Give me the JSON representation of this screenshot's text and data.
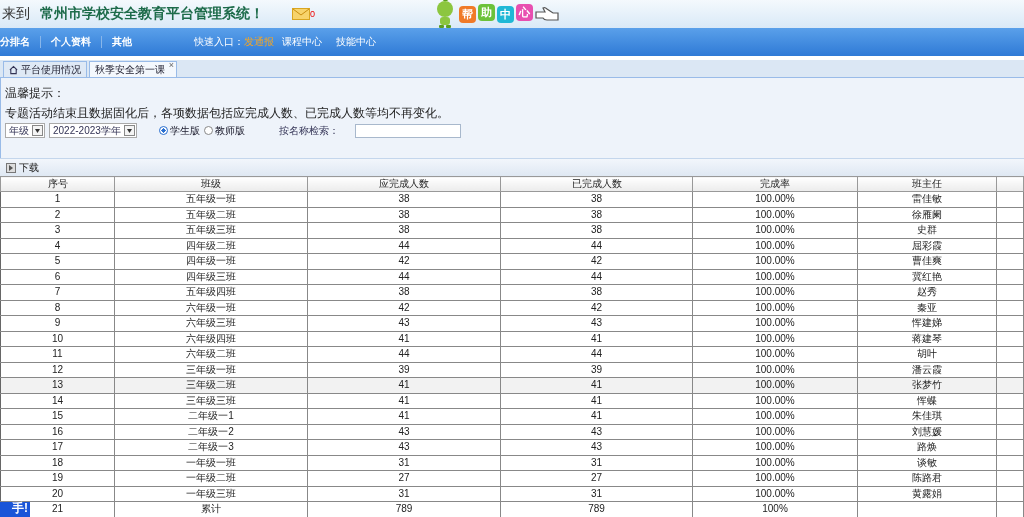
{
  "header": {
    "welcome": "来到",
    "title": "常州市学校安全教育平台管理系统！",
    "mail_count": "0",
    "help_chars": [
      {
        "text": "帮",
        "color": "#f07a28"
      },
      {
        "text": "助",
        "color": "#6cc23a"
      },
      {
        "text": "中",
        "color": "#1fb8d6"
      },
      {
        "text": "心",
        "color": "#e84fb0"
      }
    ]
  },
  "nav": {
    "items": [
      "分排名",
      "个人资料",
      "其他"
    ],
    "quick_label": "快速入口：",
    "quick_links": [
      {
        "label": "发通报",
        "highlight": true
      },
      {
        "label": "课程中心",
        "highlight": false
      },
      {
        "label": "技能中心",
        "highlight": false
      }
    ]
  },
  "tabs": [
    {
      "label": "平台使用情况",
      "selected": false,
      "home": true,
      "closable": false
    },
    {
      "label": "秋季安全第一课",
      "selected": true,
      "home": false,
      "closable": true
    }
  ],
  "tab_close": "×",
  "notice": {
    "title": "温馨提示：",
    "text": "专题活动结束且数据固化后，各项数据包括应完成人数、已完成人数等均不再变化。"
  },
  "filters": {
    "grade": "年级",
    "year": "2022-2023学年",
    "versions": [
      {
        "label": "学生版",
        "selected": true
      },
      {
        "label": "教师版",
        "selected": false
      }
    ],
    "search_label": "按名称检索："
  },
  "toolbar": {
    "download": "下载"
  },
  "table": {
    "columns": [
      "序号",
      "班级",
      "应完成人数",
      "已完成人数",
      "完成率",
      "班主任"
    ],
    "rows": [
      {
        "cells": [
          "1",
          "五年级一班",
          "38",
          "38",
          "100.00%",
          "雷佳敏"
        ],
        "highlighted": false
      },
      {
        "cells": [
          "2",
          "五年级二班",
          "38",
          "38",
          "100.00%",
          "徐雁阑"
        ],
        "highlighted": false
      },
      {
        "cells": [
          "3",
          "五年级三班",
          "38",
          "38",
          "100.00%",
          "史群"
        ],
        "highlighted": false
      },
      {
        "cells": [
          "4",
          "四年级二班",
          "44",
          "44",
          "100.00%",
          "屈彩霞"
        ],
        "highlighted": false
      },
      {
        "cells": [
          "5",
          "四年级一班",
          "42",
          "42",
          "100.00%",
          "曹佳爽"
        ],
        "highlighted": false
      },
      {
        "cells": [
          "6",
          "四年级三班",
          "44",
          "44",
          "100.00%",
          "冀红艳"
        ],
        "highlighted": false
      },
      {
        "cells": [
          "7",
          "五年级四班",
          "38",
          "38",
          "100.00%",
          "赵秀"
        ],
        "highlighted": false
      },
      {
        "cells": [
          "8",
          "六年级一班",
          "42",
          "42",
          "100.00%",
          "秦亚"
        ],
        "highlighted": false
      },
      {
        "cells": [
          "9",
          "六年级三班",
          "43",
          "43",
          "100.00%",
          "恽建娣"
        ],
        "highlighted": false
      },
      {
        "cells": [
          "10",
          "六年级四班",
          "41",
          "41",
          "100.00%",
          "蒋建琴"
        ],
        "highlighted": false
      },
      {
        "cells": [
          "11",
          "六年级二班",
          "44",
          "44",
          "100.00%",
          "胡叶"
        ],
        "highlighted": false
      },
      {
        "cells": [
          "12",
          "三年级一班",
          "39",
          "39",
          "100.00%",
          "潘云霞"
        ],
        "highlighted": false
      },
      {
        "cells": [
          "13",
          "三年级二班",
          "41",
          "41",
          "100.00%",
          "张梦竹"
        ],
        "highlighted": true
      },
      {
        "cells": [
          "14",
          "三年级三班",
          "41",
          "41",
          "100.00%",
          "恽蝶"
        ],
        "highlighted": false
      },
      {
        "cells": [
          "15",
          "二年级一1",
          "41",
          "41",
          "100.00%",
          "朱佳琪"
        ],
        "highlighted": false
      },
      {
        "cells": [
          "16",
          "二年级一2",
          "43",
          "43",
          "100.00%",
          "刘慧媛"
        ],
        "highlighted": false
      },
      {
        "cells": [
          "17",
          "二年级一3",
          "43",
          "43",
          "100.00%",
          "路焕"
        ],
        "highlighted": false
      },
      {
        "cells": [
          "18",
          "一年级一班",
          "31",
          "31",
          "100.00%",
          "谈敏"
        ],
        "highlighted": false
      },
      {
        "cells": [
          "19",
          "一年级二班",
          "27",
          "27",
          "100.00%",
          "陈路君"
        ],
        "highlighted": false
      },
      {
        "cells": [
          "20",
          "一年级三班",
          "31",
          "31",
          "100.00%",
          "黄露娟"
        ],
        "highlighted": false
      },
      {
        "cells": [
          "21",
          "累计",
          "789",
          "789",
          "100%",
          ""
        ],
        "highlighted": false
      }
    ]
  },
  "float_badge": "手!"
}
